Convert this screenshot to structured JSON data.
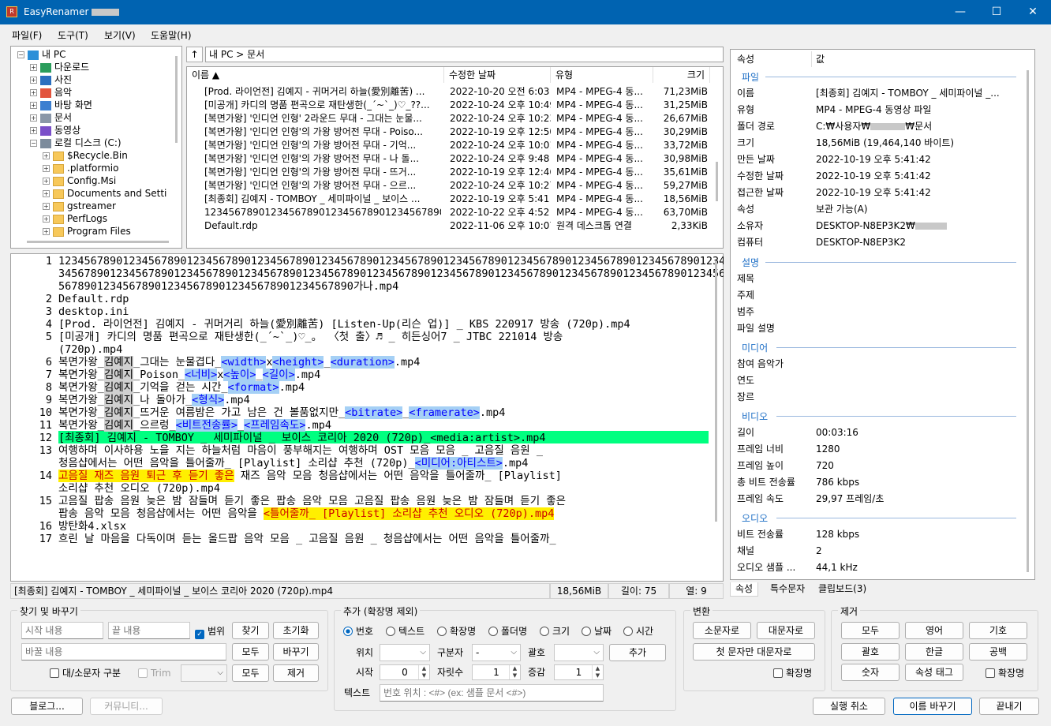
{
  "app": {
    "title": "EasyRenamer -"
  },
  "menu": [
    "파일(F)",
    "도구(T)",
    "보기(V)",
    "도움말(H)"
  ],
  "tree": [
    {
      "label": "내 PC",
      "indent": 0,
      "icon": "pc-icon",
      "exp": "−"
    },
    {
      "label": "다운로드",
      "indent": 1,
      "icon": "download-icon",
      "exp": "+"
    },
    {
      "label": "사진",
      "indent": 1,
      "icon": "pictures-icon",
      "exp": "+"
    },
    {
      "label": "음악",
      "indent": 1,
      "icon": "music-icon",
      "exp": "+"
    },
    {
      "label": "바탕 화면",
      "indent": 1,
      "icon": "desktop-icon",
      "exp": "+"
    },
    {
      "label": "문서",
      "indent": 1,
      "icon": "documents-icon",
      "exp": "+"
    },
    {
      "label": "동영상",
      "indent": 1,
      "icon": "videos-icon",
      "exp": "+"
    },
    {
      "label": "로컬 디스크 (C:)",
      "indent": 1,
      "icon": "drive-icon",
      "exp": "−"
    },
    {
      "label": "$Recycle.Bin",
      "indent": 2,
      "icon": "folder-icon",
      "exp": "+"
    },
    {
      "label": ".platformio",
      "indent": 2,
      "icon": "folder-icon",
      "exp": "+"
    },
    {
      "label": "Config.Msi",
      "indent": 2,
      "icon": "folder-icon",
      "exp": "+"
    },
    {
      "label": "Documents and Setti",
      "indent": 2,
      "icon": "folder-icon",
      "exp": "+"
    },
    {
      "label": "gstreamer",
      "indent": 2,
      "icon": "folder-icon",
      "exp": "+"
    },
    {
      "label": "PerfLogs",
      "indent": 2,
      "icon": "folder-icon",
      "exp": "+"
    },
    {
      "label": "Program Files",
      "indent": 2,
      "icon": "folder-icon",
      "exp": "+"
    }
  ],
  "path": {
    "up": "↑",
    "value": "내 PC > 문서"
  },
  "filelist": {
    "headers": [
      "이름 ▲",
      "수정한 날짜",
      "유형",
      "크기"
    ],
    "rows": [
      [
        "[Prod. 라이언전] 김예지 - 귀머거리 하늘(愛別離苦) ...",
        "2022-10-20 오전 6:03",
        "MP4 - MPEG-4 동...",
        "71,23MiB"
      ],
      [
        "[미공개] 카디의 명품 편곡으로 재탄생한(_´~`_)♡_??...",
        "2022-10-24 오후 10:49",
        "MP4 - MPEG-4 동...",
        "31,25MiB"
      ],
      [
        "[복면가왕] '인디언 인형' 2라운드 무대 - 그대는 눈물...",
        "2022-10-24 오후 10:23",
        "MP4 - MPEG-4 동...",
        "26,67MiB"
      ],
      [
        "[복면가왕] '인디언 인형'의 가왕 방어전 무대 - Poiso...",
        "2022-10-19 오후 12:50",
        "MP4 - MPEG-4 동...",
        "30,29MiB"
      ],
      [
        "[복면가왕] '인디언 인형'의 가왕 방어전 무대 - 기억...",
        "2022-10-24 오후 10:01",
        "MP4 - MPEG-4 동...",
        "33,72MiB"
      ],
      [
        "[복면가왕] '인디언 인형'의 가왕 방어전 무대 - 나 돌...",
        "2022-10-24 오후 9:48",
        "MP4 - MPEG-4 동...",
        "30,98MiB"
      ],
      [
        "[복면가왕] '인디언 인형'의 가왕 방어전 무대 - 뜨거...",
        "2022-10-19 오후 12:46",
        "MP4 - MPEG-4 동...",
        "35,61MiB"
      ],
      [
        "[복면가왕] '인디언 인형'의 가왕 방어전 무대 - 으르...",
        "2022-10-24 오후 10:27",
        "MP4 - MPEG-4 동...",
        "59,27MiB"
      ],
      [
        "[최종회] 김예지 - TOMBOY _ 세미파이널 _ 보이스 ...",
        "2022-10-19 오후 5:41",
        "MP4 - MPEG-4 동...",
        "18,56MiB"
      ],
      [
        "1234567890123456789012345678901234567890123456789012345678...",
        "2022-10-22 오후 4:52",
        "MP4 - MPEG-4 동...",
        "63,70MiB"
      ],
      [
        "Default.rdp",
        "2022-11-06 오후 10:07",
        "원격 데스크톱 연결",
        "2,33KiB"
      ]
    ]
  },
  "editor": {
    "l1a": "1234567890123456789012345678901234567890123456789012345678901234567890123456789012345678901234567890123456789012",
    "l1b": "3456789012345678901234567890123456789012345678901234567890123456789012345678901234567890123456789012345678901234",
    "l1c": "5678901234567890123456789012345678901234567890가나.mp4",
    "l2": "Default.rdp",
    "l3": "desktop.ini",
    "l4": "[Prod. 라이언전] 김예지 - 귀머거리 하늘(愛別離苦) [Listen-Up(리슨 업)] _ KBS 220917 방송 (720p).mp4",
    "l5a": "[미공개] 카디의 명품 편곡으로 재탄생한(_´~`_)♡_。 〈첫 출〉♬ _ 히든싱어7 _ JTBC 221014 방송",
    "l5b": "(720p).mp4",
    "l6a": "복면가왕_",
    "l6b": "김예지",
    "l6c": "_그대는 눈물겹다_",
    "l6d": "<width>",
    "l6e": "x",
    "l6f": "<height>",
    "l6g": "_",
    "l6h": "<duration>",
    "l6i": ".mp4",
    "l7a": "복면가왕_",
    "l7b": "김예지",
    "l7c": "_Poison_",
    "l7d": "<너비>",
    "l7e": "x",
    "l7f": "<높이>",
    "l7g": "_",
    "l7h": "<길이>",
    "l7i": ".mp4",
    "l8a": "복면가왕_",
    "l8b": "김예지",
    "l8c": "_기억을 걷는 시간_",
    "l8d": "<format>",
    "l8e": ".mp4",
    "l9a": "복면가왕_",
    "l9b": "김예지",
    "l9c": "_나 돌아가_",
    "l9d": "<형식>",
    "l9e": ".mp4",
    "l10a": "복면가왕_",
    "l10b": "김예지",
    "l10c": "_뜨거운 여름밤은 가고 남은 건 볼품없지만_",
    "l10d": "<bitrate>",
    "l10e": "_",
    "l10f": "<framerate>",
    "l10g": ".mp4",
    "l11a": "복면가왕_",
    "l11b": "김예지",
    "l11c": "_으르렁_",
    "l11d": "<비트전송률>",
    "l11e": "_",
    "l11f": "<프레임속도>",
    "l11g": ".mp4",
    "l12": "[최종회] 김예지 - TOMBOY _ 세미파이널 _ 보이스 코리아 2020 (720p)_<media:artist>.mp4",
    "l13a": "여행하며 이사하용 노을 지는 하늘처럼 마음이 풍부해지는 여행하며 OST 모음 모음 _ 고음질 음원 _",
    "l13b": "청음샵에서는 어떤 음악을 틀어줄까_ [Playlist] 소리샵 추천 (720p)_",
    "l13c": "<미디어:아티스트>",
    "l13d": ".mp4",
    "l14a": "고음질 재즈 음원 퇴근 후 듣기 좋은",
    "l14b": " 재즈 음악 모음 청음샵에서는 어떤 음악을 틀어줄까_ [Playlist]",
    "l14c": "소리샵 추천 오디오 (720p).mp4",
    "l15a": "고음질 팝송 음원 늦은 밤 잠들며 듣기 좋은 팝송 음악 모음 고음질 팝송 음원 늦은 밤 잠들며 듣기 좋은",
    "l15b": "팝송 음악 모음 청음샵에서는 어떤 음악을 ",
    "l15c": "<틀어줄까_ [Playlist] 소리샵 추천 오디오 (720p).mp4",
    "l16": "방탄화4.xlsx",
    "l17": "흐린 날 마음을 다독이며 듣는 올드팝 음악 모음 _ 고음질 음원 _ 청음샵에서는 어떤 음악을 틀어줄까_"
  },
  "statusbar": {
    "name": "[최종회] 김예지 - TOMBOY _ 세미파이널 _ 보이스 코리아 2020 (720p).mp4",
    "size": "18,56MiB",
    "length": "길이: 75",
    "col": "열: 9"
  },
  "props": {
    "h_name": "속성",
    "h_value": "값",
    "sec_file": "파일",
    "name_k": "이름",
    "name_v": "[최종회] 김예지 - TOMBOY _ 세미파이널 _...",
    "type_k": "유형",
    "type_v": "MP4 - MPEG-4 동영상 파일",
    "path_k": "폴더 경로",
    "path_v1": "C:₩사용자₩",
    "path_v2": "₩문서",
    "size_k": "크기",
    "size_v": "18,56MiB (19,464,140 바이트)",
    "created_k": "만든 날짜",
    "created_v": "2022-10-19 오후 5:41:42",
    "modified_k": "수정한 날짜",
    "modified_v": "2022-10-19 오후 5:41:42",
    "accessed_k": "접근한 날짜",
    "accessed_v": "2022-10-19 오후 5:41:42",
    "attr_k": "속성",
    "attr_v": "보관 가능(A)",
    "owner_k": "소유자",
    "owner_v": "DESKTOP-N8EP3K2₩",
    "computer_k": "컴퓨터",
    "computer_v": "DESKTOP-N8EP3K2",
    "sec_desc": "설명",
    "title_k": "제목",
    "subject_k": "주제",
    "category_k": "범주",
    "filedesc_k": "파일 설명",
    "sec_media": "미디어",
    "artist_k": "참여 음악가",
    "year_k": "연도",
    "genre_k": "장르",
    "sec_video": "비디오",
    "duration_k": "길이",
    "duration_v": "00:03:16",
    "fwidth_k": "프레임 너비",
    "fwidth_v": "1280",
    "fheight_k": "프레임 높이",
    "fheight_v": "720",
    "tbitrate_k": "총 비트 전송률",
    "tbitrate_v": "786 kbps",
    "frate_k": "프레임 속도",
    "frate_v": "29,97 프레임/초",
    "sec_audio": "오디오",
    "abitrate_k": "비트 전송률",
    "abitrate_v": "128 kbps",
    "channels_k": "채널",
    "channels_v": "2",
    "asample_k": "오디오 샘플 ...",
    "asample_v": "44,1 kHz"
  },
  "tabs": [
    "속성",
    "특수문자",
    "클립보드(3)"
  ],
  "find": {
    "title": "찾기 및 바꾸기",
    "start_placeholder": "시작 내용",
    "end_placeholder": "끝 내용",
    "range": "범위",
    "find": "찾기",
    "reset": "초기화",
    "replace_placeholder": "바꿀 내용",
    "all": "모두",
    "replace": "바꾸기",
    "case": "대/소문자 구분",
    "trim": "Trim",
    "all2": "모두",
    "remove": "제거"
  },
  "add": {
    "title": "추가 (확장명 제외)",
    "radios": [
      "번호",
      "텍스트",
      "확장명",
      "폴더명",
      "크기",
      "날짜",
      "시간"
    ],
    "pos_label": "위치",
    "sep_label": "구분자",
    "sep_value": "-",
    "paren_label": "괄호",
    "add_btn": "추가",
    "start_label": "시작",
    "start_value": "0",
    "digits_label": "자릿수",
    "digits_value": "1",
    "inc_label": "증감",
    "inc_value": "1",
    "text_label": "텍스트",
    "text_placeholder": "번호 위치 : <#> (ex: 샘플 문서 <#>)"
  },
  "convert": {
    "title": "변환",
    "lower": "소문자로",
    "upper": "대문자로",
    "first_upper": "첫 문자만 대문자로",
    "ext": "확장명"
  },
  "remove": {
    "title": "제거",
    "all": "모두",
    "english": "영어",
    "symbol": "기호",
    "paren": "괄호",
    "korean": "한글",
    "space": "공백",
    "number": "숫자",
    "attr_tag": "속성 태그",
    "ext": "확장명"
  },
  "bottom": {
    "blog": "블로그...",
    "community": "커뮤니티...",
    "undo": "실행 취소",
    "rename": "이름 바꾸기",
    "exit": "끝내기"
  }
}
